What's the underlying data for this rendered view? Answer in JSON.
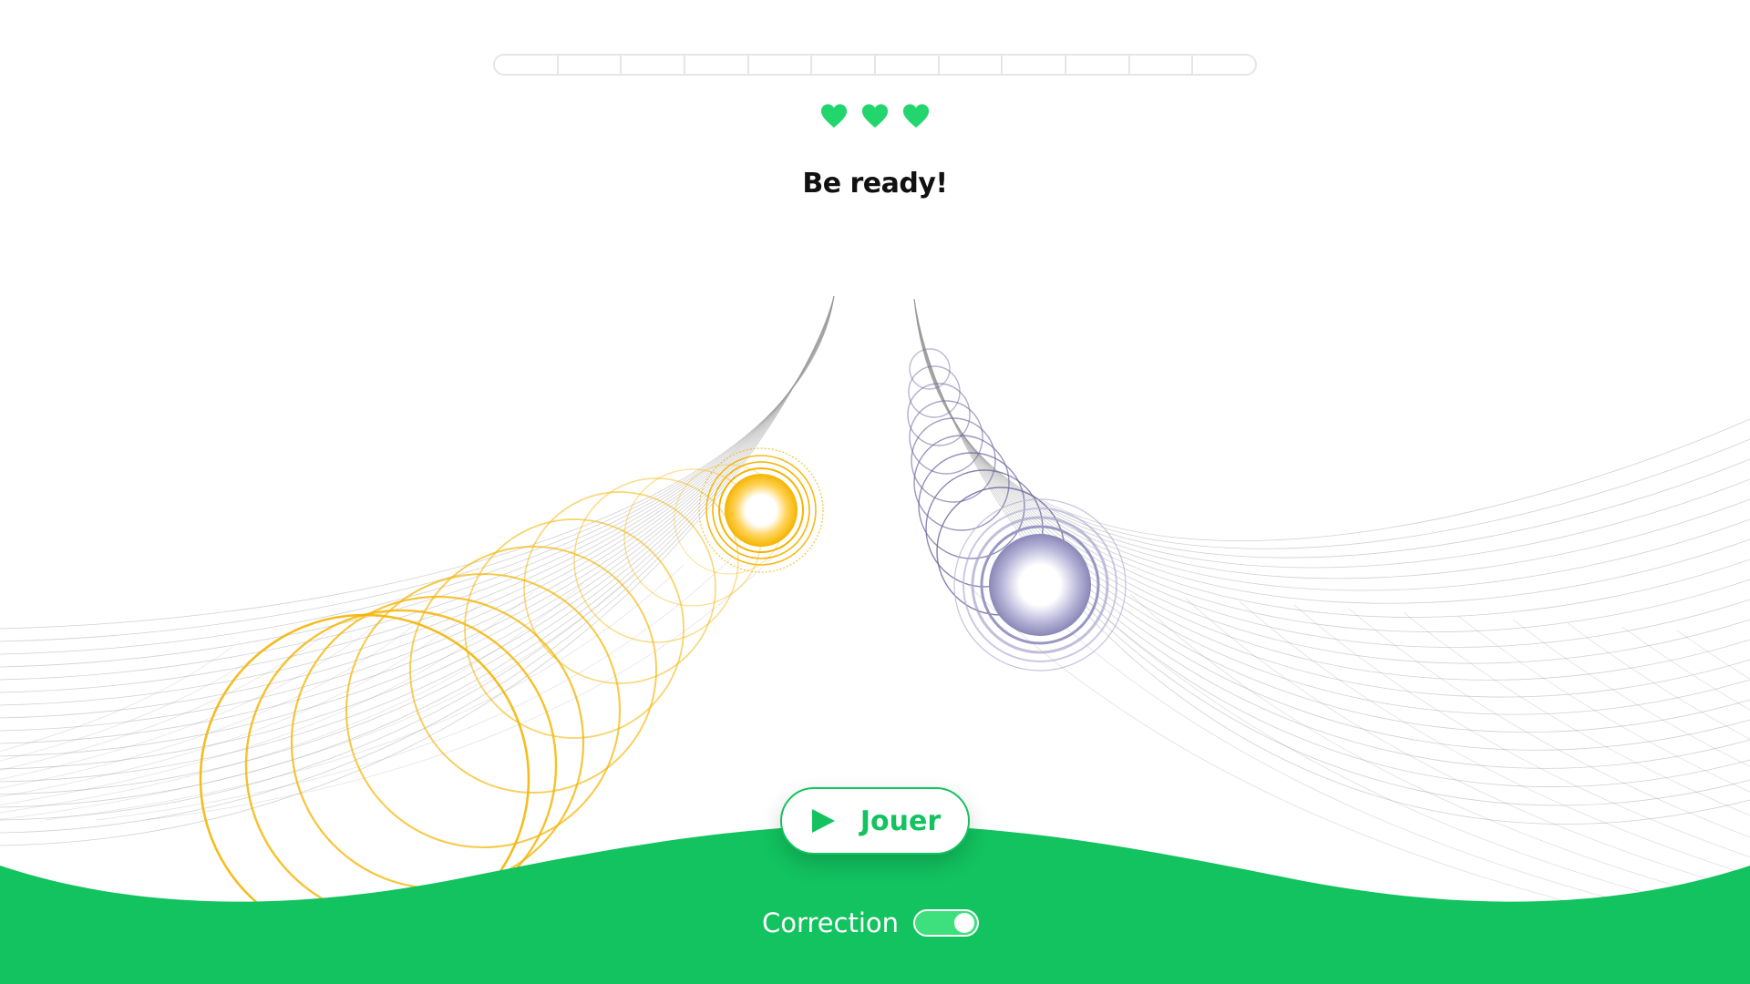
{
  "progress": {
    "segments_total": 12,
    "segments_filled": 0
  },
  "lives": {
    "count": 3,
    "icon": "heart-icon",
    "color": "#22d66d"
  },
  "status": {
    "message": "Be ready!"
  },
  "play_button": {
    "label": "Jouer",
    "icon": "play-icon"
  },
  "correction": {
    "label": "Correction",
    "enabled": true
  },
  "theme": {
    "accent": "#12c35f",
    "left_orb_color": "#f5b400",
    "right_orb_color": "#8a87b8",
    "grid_color": "#cfcfcf"
  }
}
